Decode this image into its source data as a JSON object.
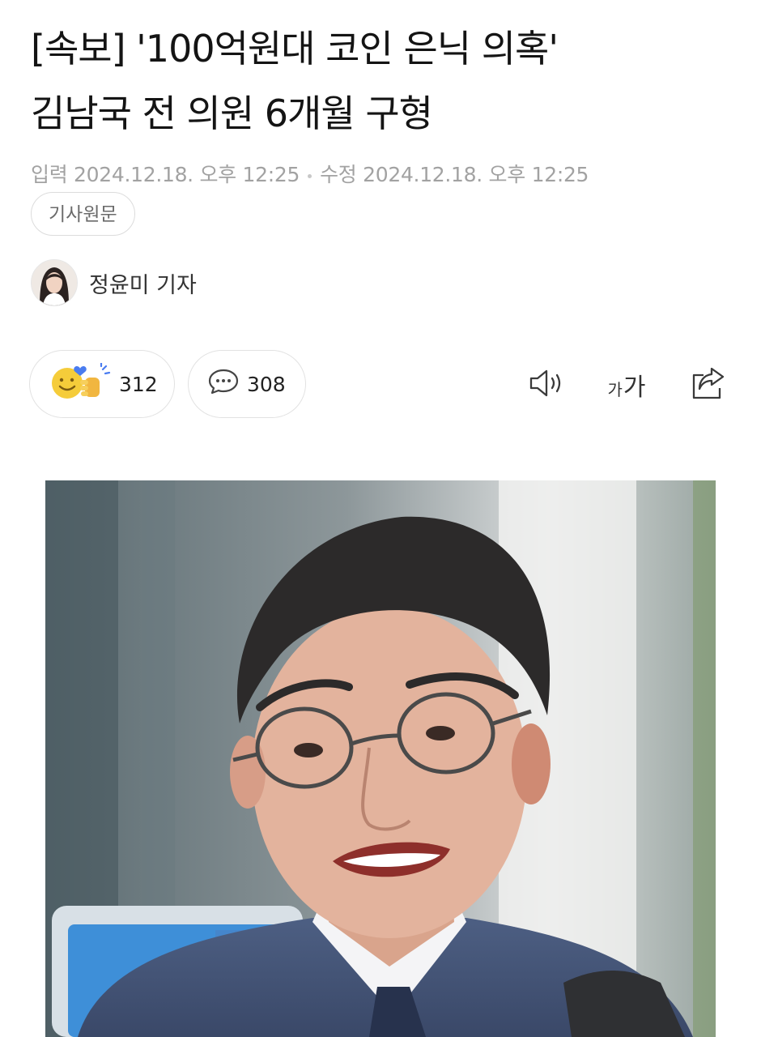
{
  "article": {
    "title_line1": "[속보] '100억원대 코인 은닉 의혹'",
    "title_line2": "김남국 전 의원 6개월 구형",
    "published": "입력 2024.12.18. 오후 12:25",
    "modified": "수정 2024.12.18. 오후 12:25",
    "original_link_label": "기사원문"
  },
  "author": {
    "name": "정윤미 기자"
  },
  "reactions": {
    "reaction_count": "312",
    "comment_count": "308"
  },
  "toolbar": {
    "font_small": "가",
    "font_large": "가"
  },
  "photo": {
    "alt": ""
  },
  "icons": [
    "reaction-emoji-icon",
    "comment-icon",
    "speaker-icon",
    "font-size-icon",
    "share-icon"
  ],
  "colors": {
    "meta_text": "#a2a2a2",
    "border": "#e2e2e2",
    "emoji_yellow": "#f5cc3a",
    "emoji_blue": "#4a7cf0"
  }
}
